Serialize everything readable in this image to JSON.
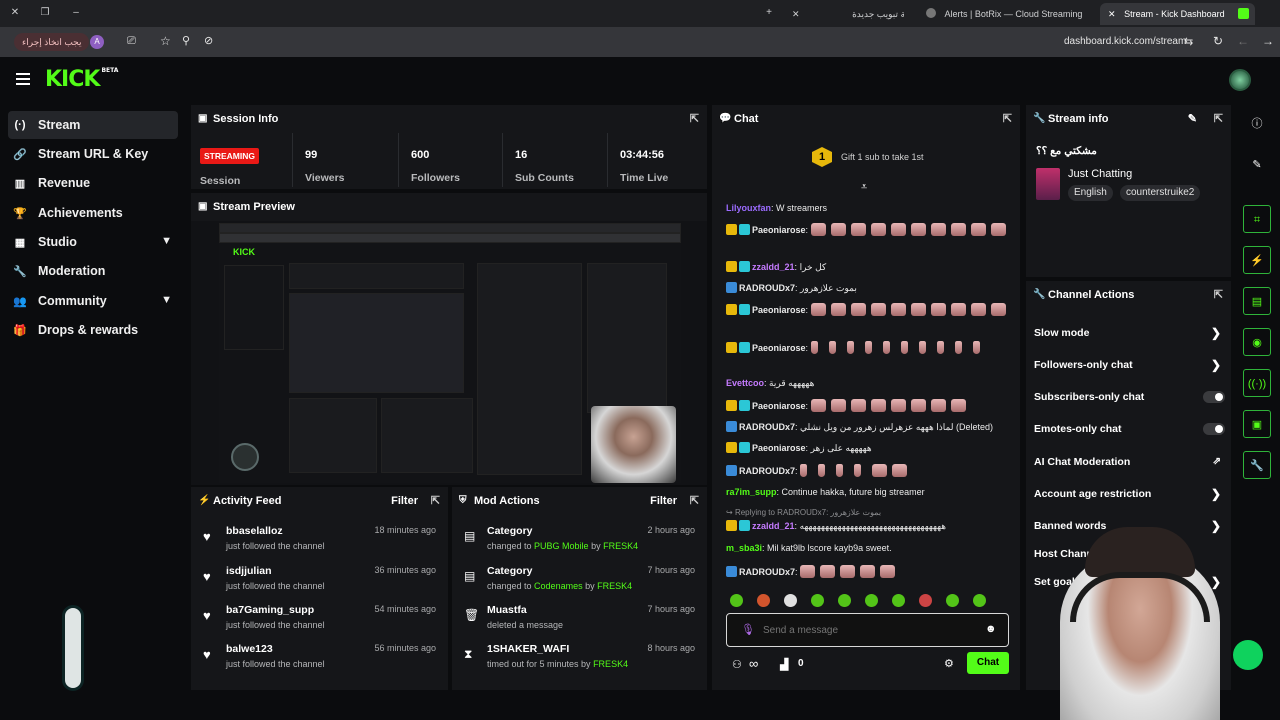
{
  "browser": {
    "tabs": [
      {
        "title": "Stream - Kick Dashboard",
        "active": true
      },
      {
        "title": "Alerts | BotRix — Cloud Streaming",
        "active": false
      },
      {
        "title": "علامة تبويب جديدة",
        "active": false
      }
    ],
    "url": "dashboard.kick.com/stream",
    "action_pill": "يجب اتخاذ إجراء",
    "profile_initial": "A"
  },
  "app": {
    "logo": "KICK",
    "logo_sup": "BETA"
  },
  "sidebar": {
    "items": [
      {
        "label": "Stream",
        "icon": "stream-icon"
      },
      {
        "label": "Stream URL & Key",
        "icon": "link-icon"
      },
      {
        "label": "Revenue",
        "icon": "revenue-icon"
      },
      {
        "label": "Achievements",
        "icon": "trophy-icon"
      },
      {
        "label": "Studio",
        "icon": "studio-icon"
      },
      {
        "label": "Moderation",
        "icon": "wrench-icon"
      },
      {
        "label": "Community",
        "icon": "community-icon"
      },
      {
        "label": "Drops & rewards",
        "icon": "gift-icon"
      }
    ]
  },
  "session": {
    "title": "Session Info",
    "status_badge": "STREAMING",
    "status_label": "Session",
    "stats": [
      {
        "value": "99",
        "label": "Viewers"
      },
      {
        "value": "600",
        "label": "Followers"
      },
      {
        "value": "16",
        "label": "Sub Counts"
      },
      {
        "value": "03:44:56",
        "label": "Time Live"
      }
    ]
  },
  "preview": {
    "title": "Stream Preview"
  },
  "activity": {
    "title": "Activity Feed",
    "filter": "Filter",
    "items": [
      {
        "name": "bbaselalloz",
        "action": "just followed the channel",
        "time": "18 minutes ago"
      },
      {
        "name": "isdjjulian",
        "action": "just followed the channel",
        "time": "36 minutes ago"
      },
      {
        "name": "ba7Gaming_supp",
        "action": "just followed the channel",
        "time": "54 minutes ago"
      },
      {
        "name": "balwe123",
        "action": "just followed the channel",
        "time": "56 minutes ago"
      }
    ]
  },
  "mod": {
    "title": "Mod Actions",
    "filter": "Filter",
    "items": [
      {
        "title": "Category",
        "pre": "changed to ",
        "target": "PUBG Mobile",
        "mid": " by ",
        "by": "FRESK4",
        "time": "2 hours ago"
      },
      {
        "title": "Category",
        "pre": "changed to ",
        "target": "Codenames",
        "mid": " by ",
        "by": "FRESK4",
        "time": "7 hours ago"
      },
      {
        "title": "Muastfa",
        "pre": "deleted a message",
        "target": "",
        "mid": "",
        "by": "",
        "time": "7 hours ago"
      },
      {
        "title": "1SHAKER_WAFI",
        "pre": "timed out for 5 minutes by ",
        "target": "",
        "mid": "",
        "by": "FRESK4",
        "time": "8 hours ago"
      }
    ]
  },
  "chat": {
    "title": "Chat",
    "gift_count": "1",
    "gift_text": "Gift 1 sub to take 1st",
    "messages": [
      {
        "user": "Lilyouxfan",
        "text": " W streamers",
        "color": "#9b6bff"
      },
      {
        "user": "Paeoniarose",
        "text": "",
        "color": "#ffffff"
      },
      {
        "user": "zzaldd_21",
        "text": " كل خرا",
        "color": "#c57bff"
      },
      {
        "user": "RADROUDx7",
        "text": " بموت علازهرور",
        "color": "#ffffff"
      },
      {
        "user": "Paeoniarose",
        "text": "",
        "color": "#ffffff"
      },
      {
        "user": "Paeoniarose",
        "text": "",
        "color": "#ffffff"
      },
      {
        "user": "Evettcoo",
        "text": " هههههه قرية",
        "color": "#c57bff"
      },
      {
        "user": "Paeoniarose",
        "text": "",
        "color": "#ffffff"
      },
      {
        "user": "RADROUDx7",
        "text": " لماذا هههه عزهرلس زهرور من ويل نشلي (Deleted)",
        "color": "#ffffff"
      },
      {
        "user": "Paeoniarose",
        "text": " هههههه على زهر",
        "color": "#ffffff"
      },
      {
        "user": "RADROUDx7",
        "text": "",
        "color": "#ffffff"
      },
      {
        "user": "ra7im_supp",
        "text": " Continue hakka, future big streamer",
        "color": "#53fc18"
      },
      {
        "user": "Replying to RADROUDx7:",
        "text": " بموت علازهرور",
        "color": "#8c8d90"
      },
      {
        "user": "zzaldd_21",
        "text": " ههههههههههههههههههههههههههههههههههه",
        "color": "#c57bff"
      },
      {
        "user": "m_sba3i",
        "text": " Mil kat9lb lscore kayb9a sweet.",
        "color": "#53fc18"
      },
      {
        "user": "RADROUDx7",
        "text": "",
        "color": "#ffffff"
      }
    ],
    "input_placeholder": "Send a message",
    "points": "0",
    "infinity": "∞",
    "send_label": "Chat"
  },
  "stream_info": {
    "title": "Stream info",
    "stream_title": "مشكتي مع ؟؟",
    "category": "Just Chatting",
    "tags": [
      "English",
      "counterstruike2"
    ]
  },
  "channel_actions": {
    "title": "Channel Actions",
    "items": [
      {
        "label": "Slow mode",
        "control": "chevron"
      },
      {
        "label": "Followers-only chat",
        "control": "chevron"
      },
      {
        "label": "Subscribers-only chat",
        "control": "toggle"
      },
      {
        "label": "Emotes-only chat",
        "control": "toggle"
      },
      {
        "label": "AI Chat Moderation",
        "control": "external"
      },
      {
        "label": "Account age restriction",
        "control": "chevron"
      },
      {
        "label": "Banned words",
        "control": "chevron"
      },
      {
        "label": "Host Channel",
        "control": "none"
      },
      {
        "label": "Set goals",
        "control": "chevron"
      }
    ]
  },
  "colors": {
    "accent": "#53fc18",
    "live": "#e91916",
    "panel": "#151619",
    "bg": "#0b0c0e"
  }
}
